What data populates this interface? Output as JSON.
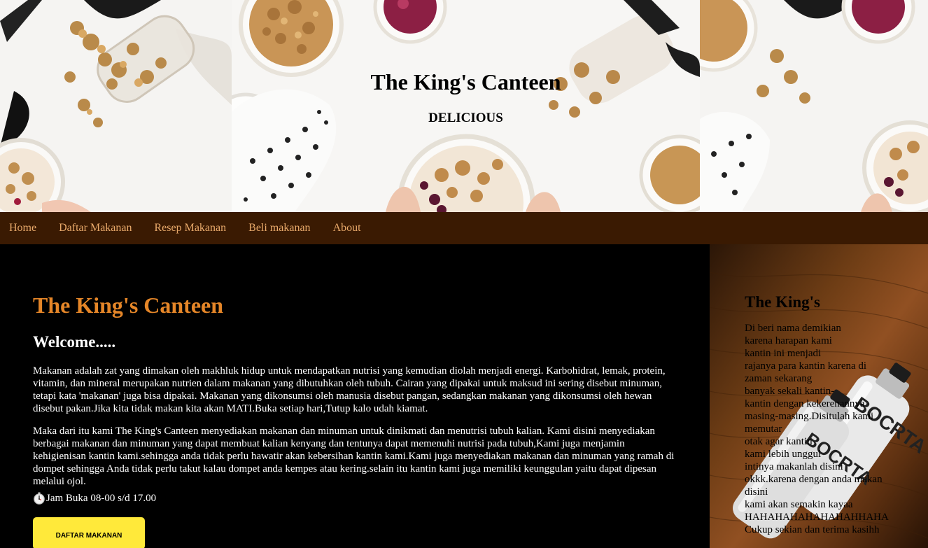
{
  "header": {
    "title": "The King's Canteen",
    "subtitle": "DELICIOUS"
  },
  "nav": {
    "items": [
      "Home",
      "Daftar Makanan",
      "Resep Makanan",
      "Beli makanan",
      "About"
    ]
  },
  "main": {
    "heading": "The King's Canteen",
    "welcome": "Welcome.....",
    "paragraph1": "Makanan adalah zat yang dimakan oleh makhluk hidup untuk mendapatkan nutrisi yang kemudian diolah menjadi energi. Karbohidrat, lemak, protein, vitamin, dan mineral merupakan nutrien dalam makanan yang dibutuhkan oleh tubuh. Cairan yang dipakai untuk maksud ini sering disebut minuman, tetapi kata 'makanan' juga bisa dipakai. Makanan yang dikonsumsi oleh manusia disebut pangan, sedangkan makanan yang dikonsumsi oleh hewan disebut pakan.Jika kita tidak makan kita akan MATI.Buka setiap hari,Tutup kalo udah kiamat.",
    "paragraph2": "Maka dari itu kami The King's Canteen menyediakan makanan dan minuman untuk dinikmati dan menutrisi tubuh kalian. Kami disini menyediakan berbagai makanan dan minuman yang dapat membuat kalian kenyang dan tentunya dapat memenuhi nutrisi pada tubuh,Kami juga menjamin kehigienisan kantin kami.sehingga anda tidak perlu hawatir akan kebersihan kantin kami.Kami juga menyediakan makanan dan minuman yang ramah di dompet sehingga Anda tidak perlu takut kalau dompet anda kempes atau kering.selain itu kantin kami juga memiliki keunggulan yaitu dapat dipesan melalui ojol.",
    "hours": "Jam Buka 08-00 s/d 17.00",
    "button_label": "DAFTAR MAKANAN"
  },
  "aside": {
    "title": "The King's",
    "lines": [
      "Di beri nama demikian",
      "karena harapan kami",
      "kantin ini menjadi",
      "rajanya para kantin karena di",
      "zaman sekarang",
      "banyak sekali kantin-",
      "kantin dengan kekerenannya",
      "masing-masing.Disitulah kami",
      "memutar",
      "otak agar kantin",
      "kami lebih unggul",
      "intinya makanlah disini",
      "okkk.karena dengan anda makan",
      "disini",
      "kami akan semakin kayaa",
      "HAHAHAHAHAHAHAHHAHA",
      "Cukup sekian dan terima kasihh"
    ],
    "bottle_text": "BOCRTA"
  },
  "colors": {
    "nav_bg": "#3a1a02",
    "nav_link": "#e8a96a",
    "heading_orange": "#e58628",
    "button_yellow": "#ffe93a"
  },
  "icons": {
    "hours_icon": "stopwatch-icon"
  }
}
